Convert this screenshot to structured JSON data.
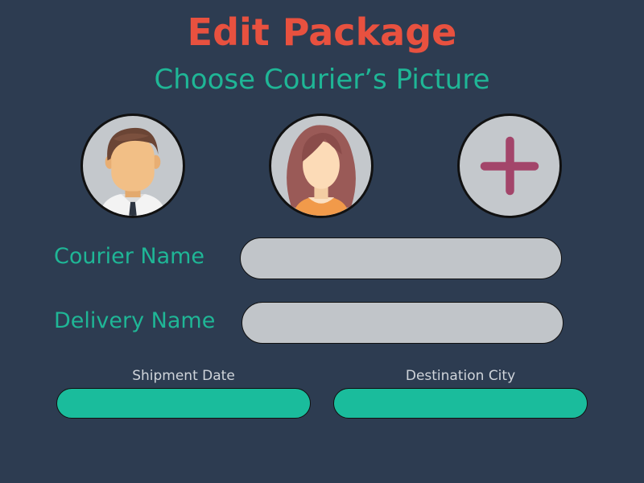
{
  "header": {
    "title": "Edit Package",
    "subtitle": "Choose Courier’s Picture"
  },
  "avatars": {
    "items": [
      {
        "name": "male-courier",
        "icon": "male-avatar-icon"
      },
      {
        "name": "female-courier",
        "icon": "female-avatar-icon"
      },
      {
        "name": "add-picture",
        "icon": "plus-icon"
      }
    ]
  },
  "form": {
    "courier_name": {
      "label": "Courier Name",
      "value": "",
      "placeholder": ""
    },
    "delivery_name": {
      "label": "Delivery Name",
      "value": "",
      "placeholder": ""
    },
    "shipment_date": {
      "label": "Shipment Date",
      "value": "",
      "placeholder": ""
    },
    "destination_city": {
      "label": "Destination City",
      "value": "",
      "placeholder": ""
    }
  },
  "colors": {
    "background": "#2d3c51",
    "title": "#e8513f",
    "accent_green": "#1fb696",
    "input_gray": "#c1c5c9",
    "input_green": "#1abc9c",
    "plus": "#a3456a"
  }
}
